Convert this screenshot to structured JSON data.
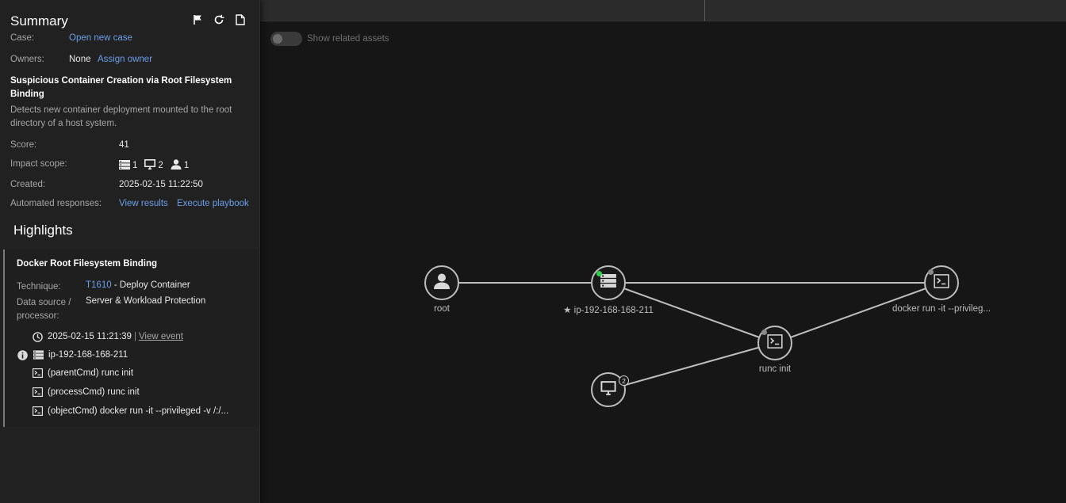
{
  "summary": {
    "title": "Summary",
    "icons": [
      "flag-icon",
      "refresh-icon",
      "document-icon"
    ],
    "case_label": "Case:",
    "case_link": "Open new case",
    "owners_label": "Owners:",
    "owners_value": "None",
    "owners_link": "Assign owner",
    "alert_title": "Suspicious Container Creation via Root Filesystem Binding",
    "alert_description": "Detects new container deployment mounted to the root directory of a host system.",
    "score_label": "Score:",
    "score_value": "41",
    "impact_label": "Impact scope:",
    "impact": {
      "servers": "1",
      "endpoints": "2",
      "accounts": "1"
    },
    "created_label": "Created:",
    "created_value": "2025-02-15 11:22:50",
    "automated_label": "Automated responses:",
    "view_results": "View results",
    "execute_playbook": "Execute playbook"
  },
  "highlights": {
    "title": "Highlights",
    "item_title": "Docker Root Filesystem Binding",
    "technique_label": "Technique:",
    "technique_id": "T1610",
    "technique_name": " - Deploy Container",
    "datasource_label": "Data source / processor:",
    "datasource_value": "Server & Workload Protection",
    "event_time": "2025-02-15 11:21:39",
    "event_sep": "|",
    "view_event": "View event",
    "host": "ip-192-168-168-211",
    "parent_cmd": "(parentCmd) runc init",
    "process_cmd": "(processCmd) runc init",
    "object_cmd": "(objectCmd) docker run -it --privileged -v /:/..."
  },
  "toggle": {
    "label": "Show related assets",
    "on": false
  },
  "graph": {
    "nodes": {
      "root": {
        "label": "root",
        "icon": "user-icon"
      },
      "host": {
        "label": "ip-192-168-168-211",
        "icon": "server-icon",
        "starred": true,
        "status_color": "#2fd14a"
      },
      "docker": {
        "label": "docker run -it --privileg...",
        "icon": "terminal-icon"
      },
      "runc": {
        "label": "runc init",
        "icon": "terminal-icon"
      },
      "endpoints": {
        "label": "",
        "icon": "monitor-icon",
        "count": "2"
      }
    },
    "edges": [
      [
        "root",
        "host"
      ],
      [
        "host",
        "docker"
      ],
      [
        "host",
        "runc"
      ],
      [
        "runc",
        "docker"
      ],
      [
        "endpoints",
        "runc"
      ]
    ]
  }
}
